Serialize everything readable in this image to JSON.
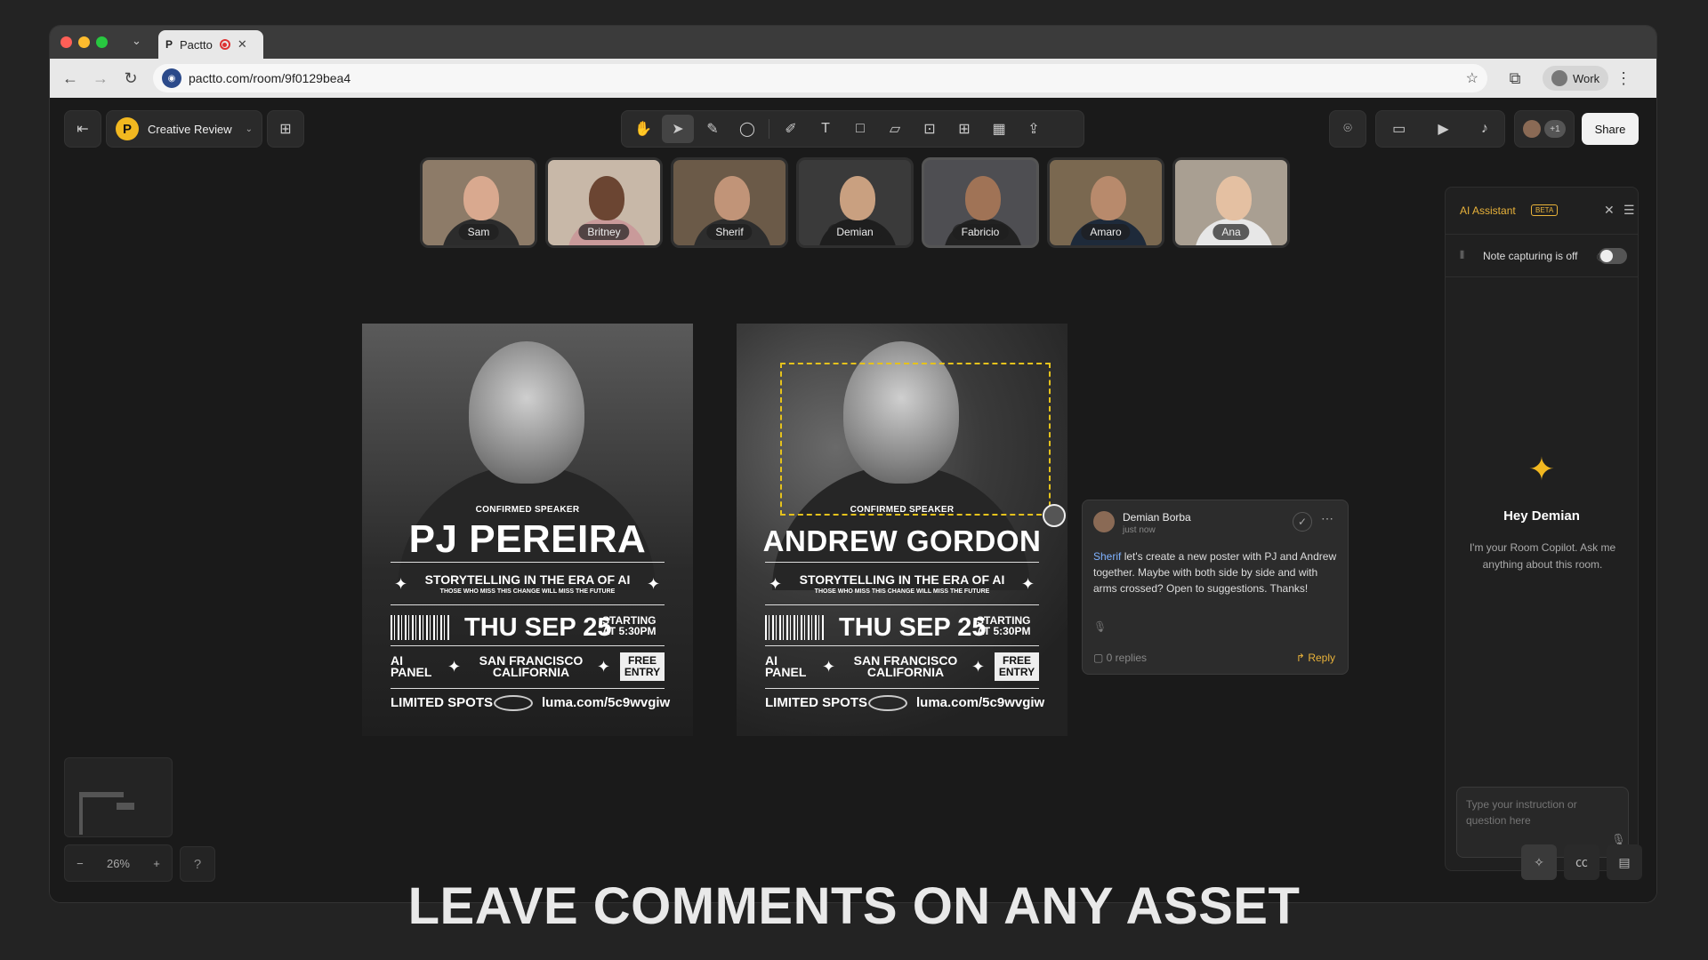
{
  "browser": {
    "tab_title": "Pactto",
    "tab_favicon": "P",
    "url": "pactto.com/room/9f0129bea4",
    "profile_label": "Work"
  },
  "app": {
    "room_name": "Creative Review",
    "room_logo": "P",
    "share_label": "Share",
    "more_participants": "+1",
    "tools": [
      "hand-icon",
      "select-icon",
      "highlighter-icon",
      "lasso-icon",
      "pen-icon",
      "text-icon",
      "shape-icon",
      "note-icon",
      "image-icon",
      "table-icon",
      "frame-icon",
      "upload-icon"
    ]
  },
  "participants": [
    {
      "name": "Sam",
      "skin": "#d9a98f",
      "shirt": "#2c2c2c",
      "bg": "#8d7b68"
    },
    {
      "name": "Britney",
      "skin": "#6b4532",
      "shirt": "#c99a9a",
      "bg": "#c8b8a8"
    },
    {
      "name": "Sherif",
      "skin": "#c19478",
      "shirt": "#2d2d2d",
      "bg": "#6b5a48"
    },
    {
      "name": "Demian",
      "skin": "#c9a080",
      "shirt": "#1e1e1e",
      "bg": "#3a3a3a"
    },
    {
      "name": "Fabricio",
      "skin": "#a07356",
      "shirt": "#222",
      "bg": "#4e4e52"
    },
    {
      "name": "Amaro",
      "skin": "#b88a6c",
      "shirt": "#1e2a3a",
      "bg": "#7a6850"
    },
    {
      "name": "Ana",
      "skin": "#e4c0a2",
      "shirt": "#e7e7e7",
      "bg": "#a99f92"
    }
  ],
  "posters": [
    {
      "confirmed": "CONFIRMED SPEAKER",
      "name": "PJ PEREIRA",
      "tagline": "STORYTELLING IN THE ERA OF AI",
      "subtagline": "THOSE WHO MISS THIS CHANGE WILL MISS THE FUTURE",
      "date": "THU SEP 25",
      "starting": "STARTING",
      "time": "AT 5:30PM",
      "panel_1": "AI",
      "panel_2": "PANEL",
      "city_1": "SAN FRANCISCO",
      "city_2": "CALIFORNIA",
      "free_1": "FREE",
      "free_2": "ENTRY",
      "limited": "LIMITED SPOTS",
      "link": "luma.com/5c9wvgiw"
    },
    {
      "confirmed": "CONFIRMED SPEAKER",
      "name": "ANDREW GORDON",
      "tagline": "STORYTELLING IN THE ERA OF AI",
      "subtagline": "THOSE WHO MISS THIS CHANGE WILL MISS THE FUTURE",
      "date": "THU SEP 25",
      "starting": "STARTING",
      "time": "AT 5:30PM",
      "panel_1": "AI",
      "panel_2": "PANEL",
      "city_1": "SAN FRANCISCO",
      "city_2": "CALIFORNIA",
      "free_1": "FREE",
      "free_2": "ENTRY",
      "limited": "LIMITED SPOTS",
      "link": "luma.com/5c9wvgiw"
    }
  ],
  "comment": {
    "author": "Demian Borba",
    "time": "just now",
    "mention": "Sherif",
    "body": " let's create a new poster with PJ and Andrew together. Maybe with both side by side and with arms crossed? Open to suggestions. Thanks!",
    "replies": "0 replies",
    "reply_label": "Reply"
  },
  "ai_assistant": {
    "title": "AI Assistant",
    "badge": "BETA",
    "note_capturing": "Note capturing is off",
    "greeting": "Hey Demian",
    "intro": "I'm your Room Copilot. Ask me anything about this room.",
    "input_placeholder": "Type your instruction or question here"
  },
  "canvas": {
    "zoom": "26%",
    "zoom_out": "−",
    "zoom_in": "+"
  },
  "caption": "LEAVE COMMENTS ON ANY ASSET",
  "colors": {
    "accent": "#f2b820",
    "selection": "#e5c21c",
    "mention": "#7fb2ff"
  }
}
